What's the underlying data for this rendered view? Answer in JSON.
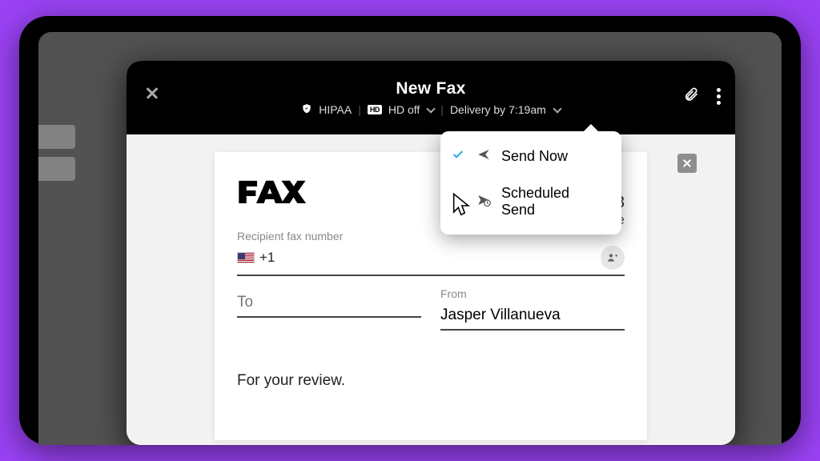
{
  "header": {
    "title": "New Fax",
    "hipaa_label": "HIPAA",
    "hd_label": "HD off",
    "delivery_label": "Delivery by 7:19am"
  },
  "dropdown": {
    "opt_now": "Send Now",
    "opt_sched": "Scheduled Send",
    "selected": "now"
  },
  "paper": {
    "logo": "FAX",
    "page_indicator_suffix": "3",
    "page_count": "1 page",
    "recipient_label": "Recipient fax number",
    "phone_prefix": "+1",
    "to_placeholder": "To",
    "from_label": "From",
    "from_value": "Jasper Villanueva",
    "message": "For your review."
  }
}
